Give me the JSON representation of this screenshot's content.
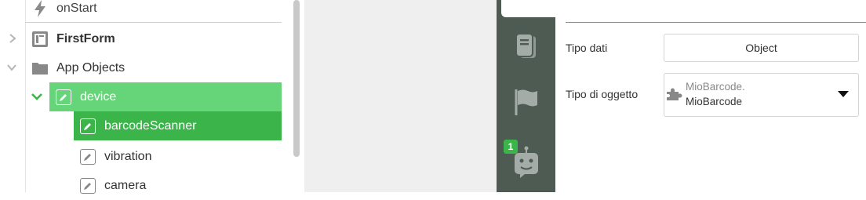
{
  "tree": {
    "items": [
      {
        "label": "onStart",
        "icon": "lightning-icon"
      },
      {
        "label": "FirstForm",
        "icon": "form-icon"
      },
      {
        "label": "App Objects",
        "icon": "folder-icon"
      },
      {
        "label": "device",
        "icon": "pencil-icon"
      },
      {
        "label": "barcodeScanner",
        "icon": "pencil-icon"
      },
      {
        "label": "vibration",
        "icon": "pencil-icon"
      },
      {
        "label": "camera",
        "icon": "pencil-icon"
      }
    ]
  },
  "sidebar": {
    "icons": [
      "book-icon",
      "flag-icon",
      "bot-icon"
    ],
    "badge": "1"
  },
  "properties": {
    "data_type": {
      "label": "Tipo dati",
      "value": "Object"
    },
    "object_type": {
      "label": "Tipo di oggetto",
      "line1": "MioBarcode.",
      "line2": "MioBarcode"
    }
  },
  "colors": {
    "selected_parent": "#66d57a",
    "selected_item": "#3bb54a",
    "sidebar": "#4e5b52",
    "accent": "#3bb54a"
  }
}
